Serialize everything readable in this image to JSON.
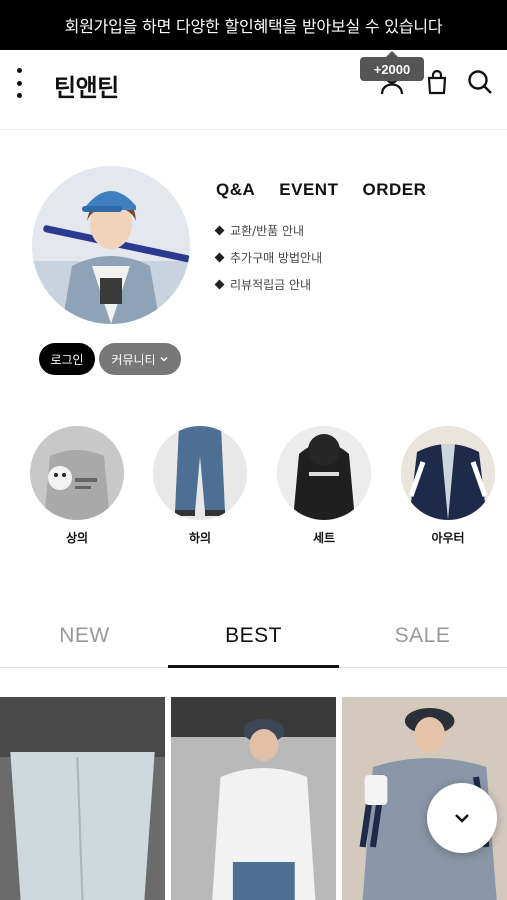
{
  "banner": {
    "text": "회원가입을 하면 다양한 할인혜택을 받아보실 수 있습니다"
  },
  "header": {
    "logo": "틴앤틴",
    "points_badge": "+2000"
  },
  "profile": {
    "links": [
      "Q&A",
      "EVENT",
      "ORDER"
    ],
    "guides": [
      "교환/반품 안내",
      "추가구매 방법안내",
      "리뷰적립금 안내"
    ],
    "login_label": "로그인",
    "community_label": "커뮤니티"
  },
  "categories": [
    "상의",
    "하의",
    "세트",
    "아우터"
  ],
  "tabs": [
    "NEW",
    "BEST",
    "SALE"
  ],
  "active_tab": "BEST",
  "icons": {
    "menu": "more-vertical-icon",
    "account": "user-icon",
    "cart": "shopping-bag-icon",
    "search": "search-icon",
    "scroll": "chevron-down-icon"
  }
}
